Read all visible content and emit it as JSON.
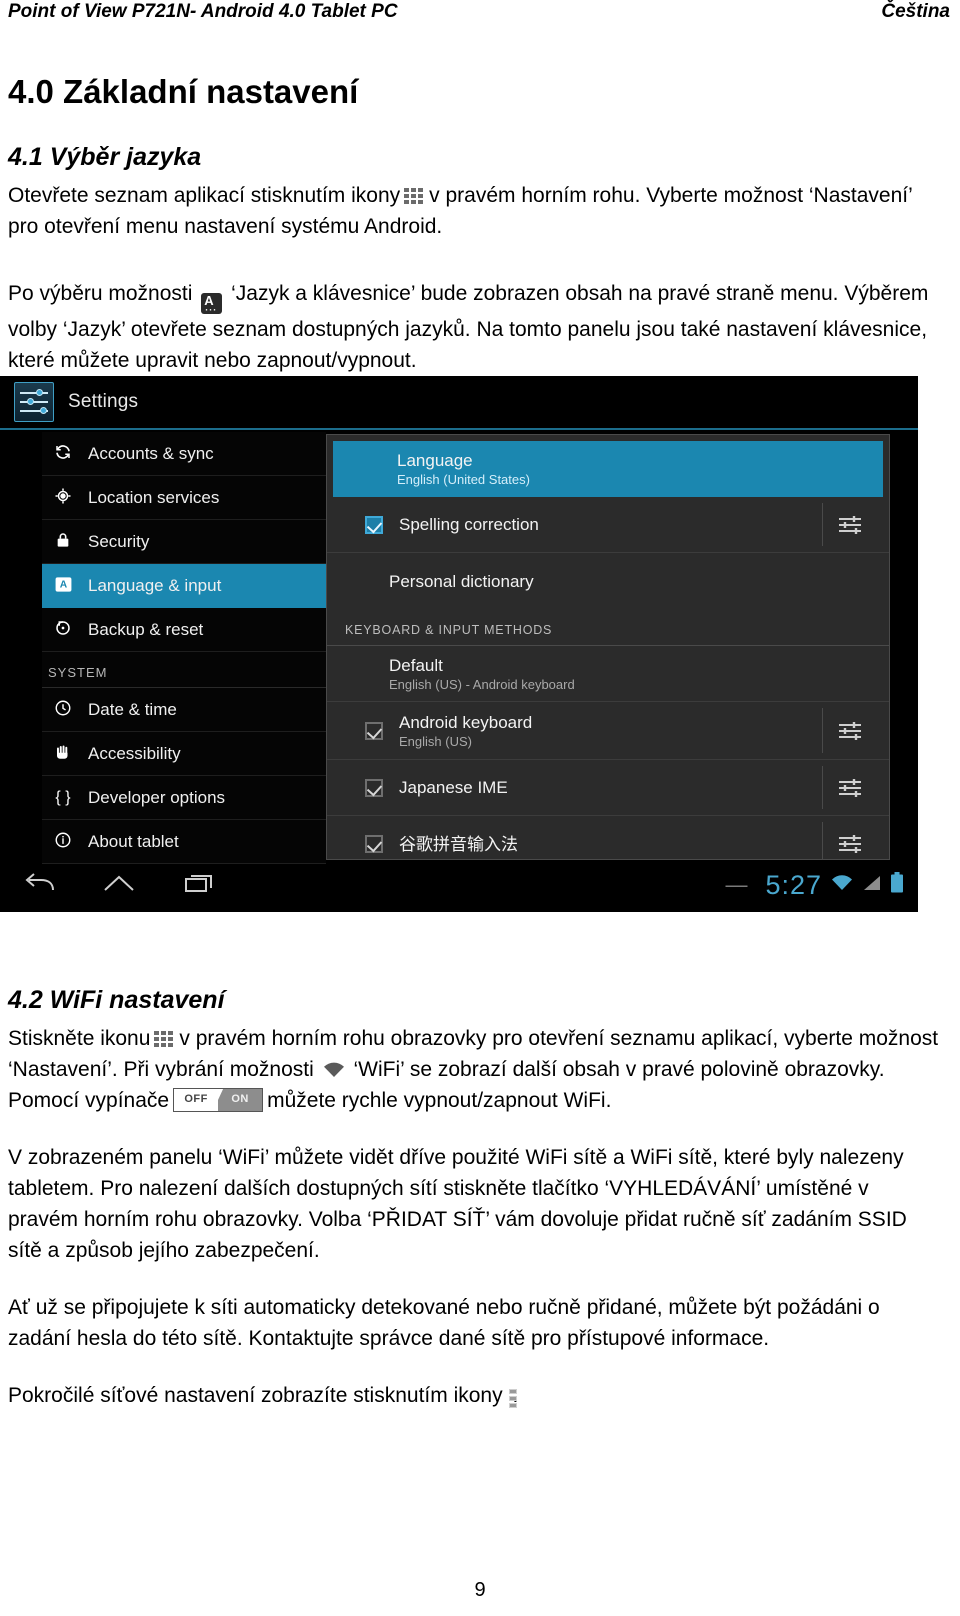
{
  "header": {
    "left": "Point of View P721N- Android 4.0 Tablet PC",
    "right": "Čeština"
  },
  "section": {
    "title": "4.0 Základní nastavení",
    "sub_4_1": "4.1 Výběr jazyka",
    "p1_a": "Otevřete seznam aplikací stisknutím ikony",
    "p1_b": "v pravém horním rohu. Vyberte možnost ‘Nastavení’ pro otevření menu nastavení systému Android.",
    "p2_a": "Po výběru možnosti",
    "p2_b": "‘Jazyk a klávesnice’ bude zobrazen obsah na pravé straně menu. Výběrem volby ‘Jazyk’ otevřete seznam dostupných jazyků. Na tomto panelu jsou také nastavení klávesnice, které můžete upravit nebo zapnout/vypnout.",
    "sub_4_2": "4.2 WiFi nastavení",
    "p3_a": "Stiskněte ikonu",
    "p3_b": "v pravém horním rohu obrazovky pro otevření seznamu aplikací, vyberte možnost ‘Nastavení’. Při vybrání možnosti",
    "p3_c": "‘WiFi’ se zobrazí další obsah v pravé polovině obrazovky. Pomocí vypínače",
    "p3_d": "můžete rychle vypnout/zapnout WiFi.",
    "p4": "V zobrazeném panelu ‘WiFi’ můžete vidět dříve použité WiFi sítě a WiFi sítě, které byly nalezeny tabletem. Pro nalezení dalších dostupných sítí stiskněte tlačítko ‘VYHLEDÁVÁNÍ’ umístěné v pravém horním rohu obrazovky. Volba ‘PŘIDAT SÍŤ’ vám dovoluje přidat ručně síť zadáním SSID sítě a způsob jejího zabezpečení.",
    "p5": "Ať už se připojujete k síti automaticky detekované nebo ručně přidané, můžete být požádáni o zadání hesla do této sítě. Kontaktujte správce dané sítě pro přístupové informace.",
    "p6_a": "Pokročilé síťové nastavení zobrazíte stisknutím ikony",
    "p6_b": "."
  },
  "toggle": {
    "off": "OFF",
    "on": "ON"
  },
  "android": {
    "title": "Settings",
    "sidebar": [
      {
        "label": "Accounts & sync",
        "icon": "sync-icon",
        "glyph": "↻",
        "selected": false
      },
      {
        "label": "Location services",
        "icon": "location-icon",
        "glyph": "◈",
        "selected": false
      },
      {
        "label": "Security",
        "icon": "lock-icon",
        "glyph": "🔒",
        "selected": false
      },
      {
        "label": "Language & input",
        "icon": "language-icon",
        "glyph": "A",
        "selected": true
      },
      {
        "label": "Backup & reset",
        "icon": "backup-reset-icon",
        "glyph": "↺",
        "selected": false
      }
    ],
    "section_label": "SYSTEM",
    "sidebar_system": [
      {
        "label": "Date & time",
        "icon": "clock-icon",
        "glyph": "🕐"
      },
      {
        "label": "Accessibility",
        "icon": "hand-icon",
        "glyph": "✋"
      },
      {
        "label": "Developer options",
        "icon": "braces-icon",
        "glyph": "{ }"
      },
      {
        "label": "About tablet",
        "icon": "info-icon",
        "glyph": "ⓘ"
      }
    ],
    "panel": {
      "language_title": "Language",
      "language_value": "English (United States)",
      "spelling_title": "Spelling correction",
      "personal_dictionary": "Personal dictionary",
      "group_label": "KEYBOARD & INPUT METHODS",
      "default_title": "Default",
      "default_value": "English (US) - Android keyboard",
      "android_kb_title": "Android keyboard",
      "android_kb_value": "English (US)",
      "japanese_ime": "Japanese IME",
      "pinyin": "谷歌拼音输入法"
    },
    "statusbar": {
      "clock": "5:27"
    },
    "colors": {
      "accent": "#1b87b0",
      "panel_bg": "#2b2b2b",
      "sidebar_bg": "#050505",
      "clock": "#4aa8cf"
    }
  },
  "footer": {
    "page_number": "9"
  }
}
